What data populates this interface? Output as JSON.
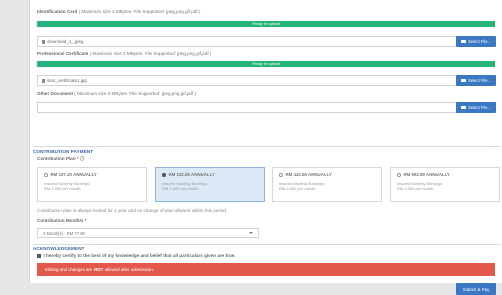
{
  "documents": [
    {
      "label": "Identification Card",
      "hint": "( Maximum size 3 MBytes. File Supported: jpeg,png,gif,pdf )",
      "status": "Ready for upload",
      "file": "download_1_.jpeg",
      "button": "Select File..."
    },
    {
      "label": "Professional Certificate",
      "hint": "( Maximum size 3 MBytes. File Supported: jpeg,png,gif,pdf )",
      "status": "Ready for upload",
      "file": "ssm_certificate1.jpg",
      "button": "Select File..."
    },
    {
      "label": "Other Document",
      "hint": "( Maximum size 3 MBytes. File Supported: jpeg,png,gif,pdf )",
      "file": "",
      "button": "Select File..."
    }
  ],
  "contribution": {
    "section_title": "CONTRIBUTION PAYMENT",
    "plan_label": "Contribution Plan * ⓘ",
    "plans": [
      {
        "price": "RM 157.20 ANNUALLY",
        "desc1": "Insured Monthly Earnings",
        "desc2": "RM 1,050 per month",
        "selected": false
      },
      {
        "price": "RM 232.80 ANNUALLY",
        "desc1": "Insured Monthly Earnings",
        "desc2": "RM 1,550 per month",
        "selected": true
      },
      {
        "price": "RM 442.80 ANNUALLY",
        "desc1": "Insured Monthly Earnings",
        "desc2": "RM 2,950 per month",
        "selected": false
      },
      {
        "price": "RM 592.80 ANNUALLY",
        "desc1": "Insured Monthly Earnings",
        "desc2": "RM 3,950 per month",
        "selected": false
      }
    ],
    "note": "Contribution plan is always locked for 1 year and no change of plan allowed within this period.",
    "months_label": "Contribution Month/s *",
    "months_value": "4 Month(s) - RM 77.60"
  },
  "acknowledgement": {
    "section_title": "ACKNOWLEDGEMENT",
    "statement": "I hereby certify to the best of my knowledge and belief that all particulars given are true.",
    "alert_prefix": "Editing and changes are ",
    "alert_strong": "NOT",
    "alert_suffix": " allowed after submission."
  },
  "submit_label": "Submit & Pay",
  "colors": {
    "ready_bar": "#25b57a",
    "primary_button": "#3a78c4",
    "alert": "#e2594c",
    "section_title": "#3a66a8",
    "selected_plan_bg": "#dce9f6"
  }
}
